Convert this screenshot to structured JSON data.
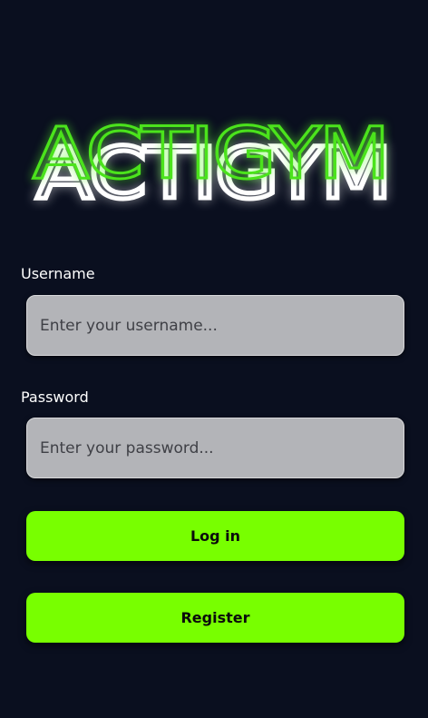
{
  "app": {
    "logo_text": "ACTIGYM"
  },
  "form": {
    "username_label": "Username",
    "username_placeholder": "Enter your username...",
    "username_value": "",
    "password_label": "Password",
    "password_placeholder": "Enter your password...",
    "password_value": "",
    "login_label": "Log in",
    "register_label": "Register"
  },
  "colors": {
    "background": "#0a0f1f",
    "accent": "#78ff00",
    "logo_green": "#4be31c",
    "input_bg": "#b3b4b8"
  }
}
